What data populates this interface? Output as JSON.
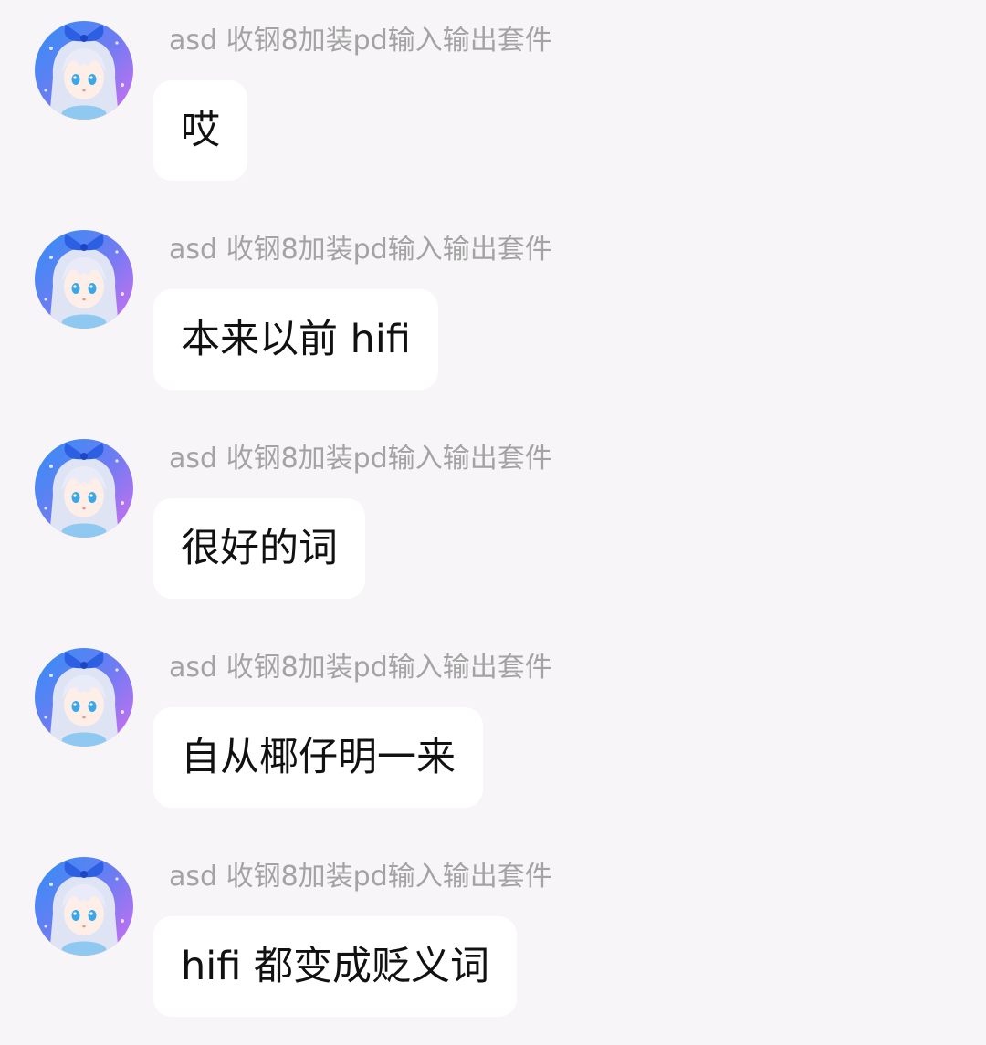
{
  "messages": [
    {
      "sender": "asd 收钢8加装pd输入输出套件",
      "text": "哎",
      "avatar": "anime-girl-avatar"
    },
    {
      "sender": "asd 收钢8加装pd输入输出套件",
      "text": "本来以前 hifi",
      "avatar": "anime-girl-avatar"
    },
    {
      "sender": "asd 收钢8加装pd输入输出套件",
      "text": "很好的词",
      "avatar": "anime-girl-avatar"
    },
    {
      "sender": "asd 收钢8加装pd输入输出套件",
      "text": "自从椰仔明一来",
      "avatar": "anime-girl-avatar"
    },
    {
      "sender": "asd 收钢8加装pd输入输出套件",
      "text": "hifi 都变成贬义词",
      "avatar": "anime-girl-avatar"
    }
  ],
  "colors": {
    "background": "#f7f5f7",
    "bubble": "#ffffff",
    "sender_text": "#a3a3a3",
    "message_text": "#111111",
    "avatar_bg_top": "#3a6ff0",
    "avatar_bg_bottom": "#c86df0",
    "avatar_bow": "#2f5fe0"
  }
}
